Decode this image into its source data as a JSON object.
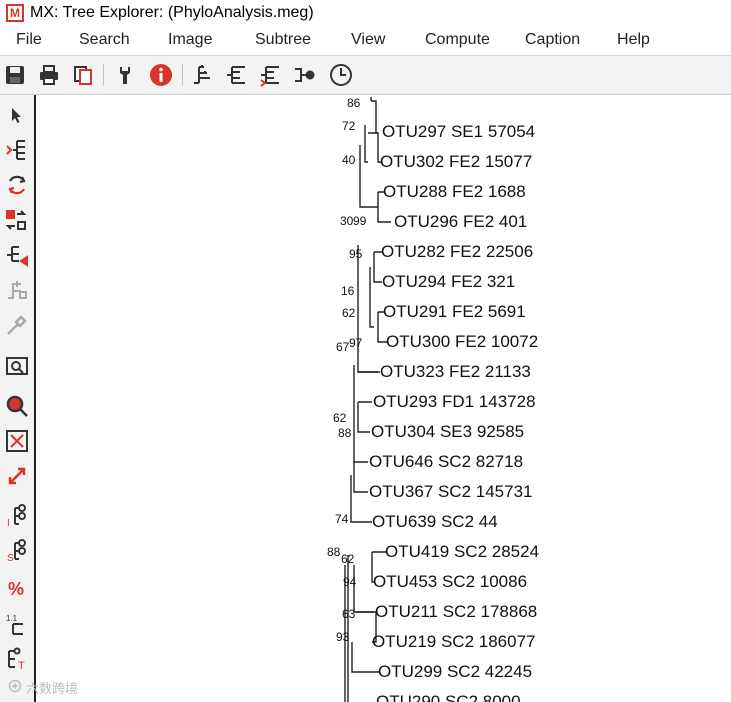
{
  "window": {
    "title": "MX: Tree Explorer: (PhyloAnalysis.meg)",
    "logo_letter": "M"
  },
  "menu": [
    "File",
    "Search",
    "Image",
    "Subtree",
    "View",
    "Compute",
    "Caption",
    "Help"
  ],
  "toolbar_icons": [
    "save-icon",
    "print-icon",
    "copy-icon",
    "options-icon",
    "info-icon",
    "tree-layout-icon",
    "tree-layout-alt-icon",
    "tree-layout-red-icon",
    "node-icon",
    "clock-icon"
  ],
  "sidebar_icons": [
    "pointer-icon",
    "place-root-icon",
    "swap-icon",
    "flip-icon",
    "compress-icon",
    "subtree-icon",
    "wrench-icon",
    "search-icon",
    "zoom-icon",
    "fit-icon",
    "resize-icon",
    "info-node-icon",
    "stats-icon",
    "percent-icon",
    "branch-length-icon",
    "topology-icon"
  ],
  "tree": {
    "otus": [
      "OTU297 SE1 57054",
      "OTU302 FE2 15077",
      "OTU288 FE2 1688",
      "OTU296 FE2 401",
      "OTU282 FE2 22506",
      "OTU294 FE2 321",
      "OTU291 FE2 5691",
      "OTU300 FE2 10072",
      "OTU323 FE2 21133",
      "OTU293 FD1 143728",
      "OTU304 SE3 92585",
      "OTU646 SC2 82718",
      "OTU367 SC2 145731",
      "OTU639 SC2 44",
      "OTU419 SC2 28524",
      "OTU453 SC2 10086",
      "OTU211 SC2 178868",
      "OTU219 SC2 186077",
      "OTU299 SC2 42245",
      "OTU290 SC2 8000"
    ],
    "bootstrap": [
      "86",
      "72",
      "40",
      "30",
      "99",
      "95",
      "16",
      "62",
      "67",
      "97",
      "62",
      "88",
      "74",
      "88",
      "62",
      "94",
      "63",
      "93"
    ]
  },
  "watermark": "六数跨境"
}
